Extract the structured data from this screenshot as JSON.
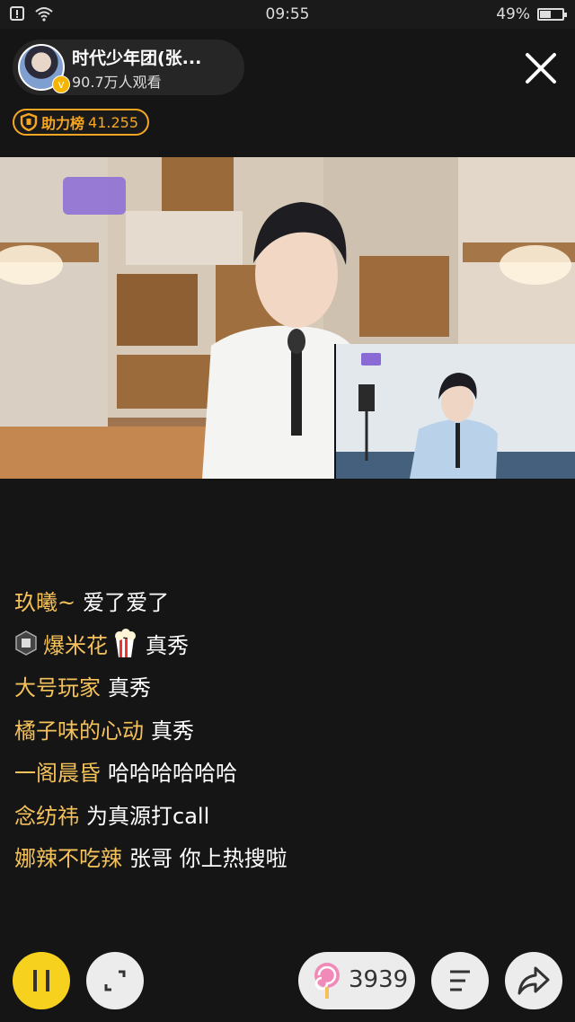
{
  "status_bar": {
    "time": "09:55",
    "battery": "49%",
    "battery_level": 0.49
  },
  "host": {
    "name": "时代少年团(张...",
    "viewers": "90.7万人观看"
  },
  "rank": {
    "label": "助力榜",
    "value": "41.255"
  },
  "chat": [
    {
      "user": "玖曦~",
      "message": "爱了爱了",
      "badge": false,
      "popcorn": false
    },
    {
      "user": "爆米花",
      "message": "真秀",
      "badge": true,
      "popcorn": true
    },
    {
      "user": "大号玩家",
      "message": "真秀",
      "badge": false,
      "popcorn": false
    },
    {
      "user": "橘子味的心动",
      "message": "真秀",
      "badge": false,
      "popcorn": false
    },
    {
      "user": "一阁晨昏",
      "message": "哈哈哈哈哈哈",
      "badge": false,
      "popcorn": false
    },
    {
      "user": "念纺祎",
      "message": "为真源打call",
      "badge": false,
      "popcorn": false
    },
    {
      "user": "娜辣不吃辣",
      "message": "张哥 你上热搜啦",
      "badge": false,
      "popcorn": false
    }
  ],
  "gift": {
    "count": "3939"
  },
  "icons": {
    "pause": "pause-icon",
    "fullscreen": "fullscreen-icon",
    "menu": "menu-icon",
    "share": "share-icon",
    "close": "close-icon",
    "lollipop": "lollipop-icon",
    "shield": "shield-icon"
  },
  "colors": {
    "accent_yellow": "#f6d21f",
    "username": "#f5c25a",
    "rank_orange": "#f5a623"
  }
}
